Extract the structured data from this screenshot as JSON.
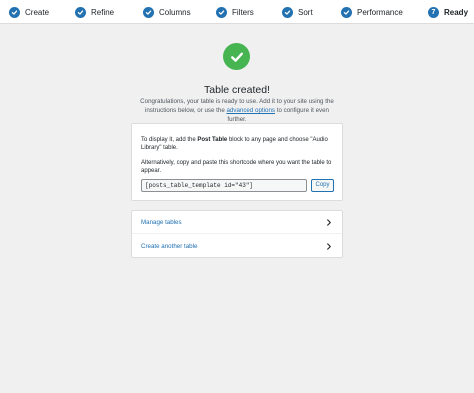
{
  "steps": [
    {
      "label": "Create",
      "state": "complete"
    },
    {
      "label": "Refine",
      "state": "complete"
    },
    {
      "label": "Columns",
      "state": "complete"
    },
    {
      "label": "Filters",
      "state": "complete"
    },
    {
      "label": "Sort",
      "state": "complete"
    },
    {
      "label": "Performance",
      "state": "complete"
    },
    {
      "label": "Ready",
      "state": "current",
      "number": "7"
    }
  ],
  "success": {
    "title": "Table created!",
    "intro_before_link": "Congratulations, your table is ready to use. Add it to your site using the instructions below, or use the ",
    "intro_link": "advanced options",
    "intro_after_link": " to configure it even further."
  },
  "display_card": {
    "p1_before": "To display it, add the ",
    "p1_bold": "Post Table",
    "p1_after": " block to any page and choose \"Audio Library\" table.",
    "p2": "Alternatively, copy and paste this shortcode where you want the table to appear.",
    "shortcode": "[posts_table_template id=\"43\"]",
    "copy_label": "Copy"
  },
  "links": [
    {
      "label": "Manage tables",
      "icon": "chevron-right-icon"
    },
    {
      "label": "Create another table",
      "icon": "chevron-right-icon"
    }
  ],
  "colors": {
    "accent": "#2271b1",
    "success": "#46b450",
    "background": "#f0f0f1"
  }
}
